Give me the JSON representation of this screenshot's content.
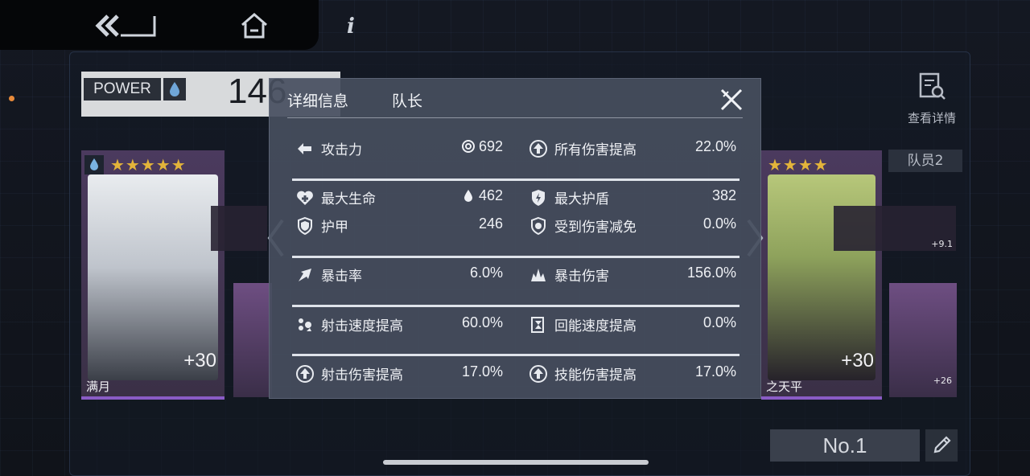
{
  "topbar": {
    "back_label": "",
    "home_label": "",
    "info_label": "i"
  },
  "power": {
    "label": "POWER",
    "value": "146"
  },
  "cards": {
    "left": {
      "name": "满月",
      "plus": "+30",
      "stars": "★★★★★"
    },
    "right": {
      "name": "之天平",
      "plus": "+30",
      "stars": "★★★★"
    },
    "mini_b_plus": "+26",
    "weapon_b_plus": "+9.1"
  },
  "member_label": "队员2",
  "view_detail_label": "查看详情",
  "team_number": "No.1",
  "modal": {
    "title": "详细信息",
    "subtitle": "队长",
    "stats": [
      {
        "left": {
          "icon": "attack-icon",
          "label": "攻击力",
          "value": "692",
          "value_icon": "swirl-icon"
        },
        "right": {
          "icon": "up-arrow-icon",
          "label": "所有伤害提高",
          "value": "22.0%"
        }
      },
      {
        "left": {
          "icon": "heart-plus-icon",
          "label": "最大生命",
          "value": "462",
          "value_icon": "drop-icon"
        },
        "right": {
          "icon": "shield-bolt-icon",
          "label": "最大护盾",
          "value": "382"
        }
      },
      {
        "left": {
          "icon": "armor-icon",
          "label": "护甲",
          "value": "246"
        },
        "right": {
          "icon": "damage-reduce-icon",
          "label": "受到伤害减免",
          "value": "0.0%"
        }
      },
      {
        "left": {
          "icon": "crit-rate-icon",
          "label": "暴击率",
          "value": "6.0%"
        },
        "right": {
          "icon": "crit-damage-icon",
          "label": "暴击伤害",
          "value": "156.0%"
        }
      },
      {
        "left": {
          "icon": "fire-rate-icon",
          "label": "射击速度提高",
          "value": "60.0%"
        },
        "right": {
          "icon": "energy-regen-icon",
          "label": "回能速度提高",
          "value": "0.0%"
        }
      },
      {
        "left": {
          "icon": "up-arrow-icon",
          "label": "射击伤害提高",
          "value": "17.0%"
        },
        "right": {
          "icon": "up-arrow-icon",
          "label": "技能伤害提高",
          "value": "17.0%"
        }
      }
    ]
  },
  "colors": {
    "modal_bg": "#464e5e",
    "accent_star": "#e3b43a",
    "card_purple": "#4b3a5e",
    "divider": "#dfe3ea"
  }
}
